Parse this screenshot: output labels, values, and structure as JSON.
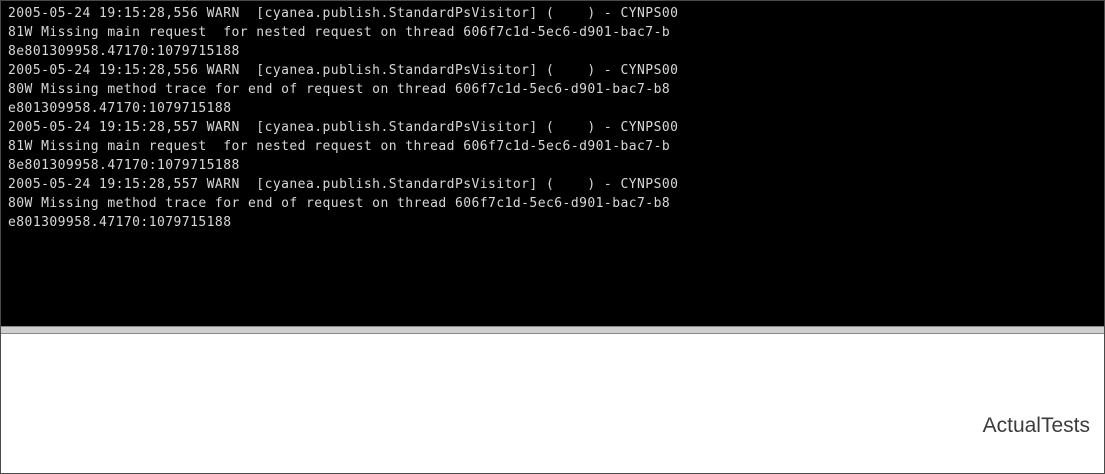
{
  "console": {
    "lines": [
      "2005-05-24 19:15:28,556 WARN  [cyanea.publish.StandardPsVisitor] (    ) - CYNPS00",
      "81W Missing main request  for nested request on thread 606f7c1d-5ec6-d901-bac7-b",
      "8e801309958.47170:1079715188",
      "2005-05-24 19:15:28,556 WARN  [cyanea.publish.StandardPsVisitor] (    ) - CYNPS00",
      "80W Missing method trace for end of request on thread 606f7c1d-5ec6-d901-bac7-b8",
      "e801309958.47170:1079715188",
      "2005-05-24 19:15:28,557 WARN  [cyanea.publish.StandardPsVisitor] (    ) - CYNPS00",
      "81W Missing main request  for nested request on thread 606f7c1d-5ec6-d901-bac7-b",
      "8e801309958.47170:1079715188",
      "2005-05-24 19:15:28,557 WARN  [cyanea.publish.StandardPsVisitor] (    ) - CYNPS00",
      "80W Missing method trace for end of request on thread 606f7c1d-5ec6-d901-bac7-b8",
      "e801309958.47170:1079715188"
    ]
  },
  "watermark": {
    "text": "ActualTests"
  },
  "colors": {
    "console_background": "#000000",
    "console_text": "#d8d8d8"
  }
}
